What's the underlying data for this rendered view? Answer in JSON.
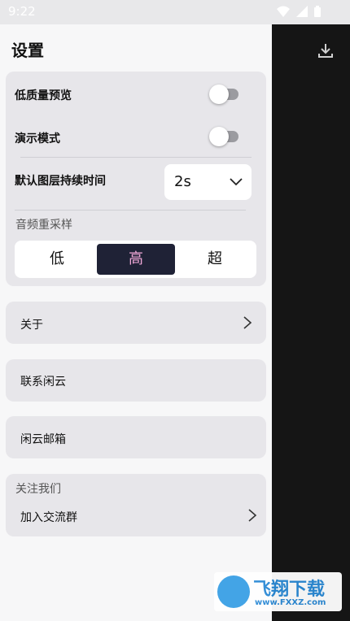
{
  "status_bar": {
    "time": "9:22"
  },
  "page_title": "设置",
  "settings": {
    "low_quality_preview": {
      "label": "低质量预览",
      "enabled": false
    },
    "demo_mode": {
      "label": "演示模式",
      "enabled": false
    },
    "default_layer_duration": {
      "label": "默认图层持续时间",
      "value": "2s"
    },
    "audio_resample": {
      "label": "音频重采样",
      "options": [
        "低",
        "高",
        "超"
      ],
      "selected": "高"
    }
  },
  "links": {
    "about": "关于",
    "contact": "联系闲云",
    "email": "闲云邮箱"
  },
  "follow": {
    "section_label": "关注我们",
    "join_group": "加入交流群"
  },
  "watermark": {
    "text": "飞翔下载",
    "url": "www.FXXZ.com"
  },
  "colors": {
    "accent_bg": "#1f2236",
    "accent_text": "#f0a8d8",
    "card_bg": "#e7e6ea",
    "overlay": "#151515"
  }
}
